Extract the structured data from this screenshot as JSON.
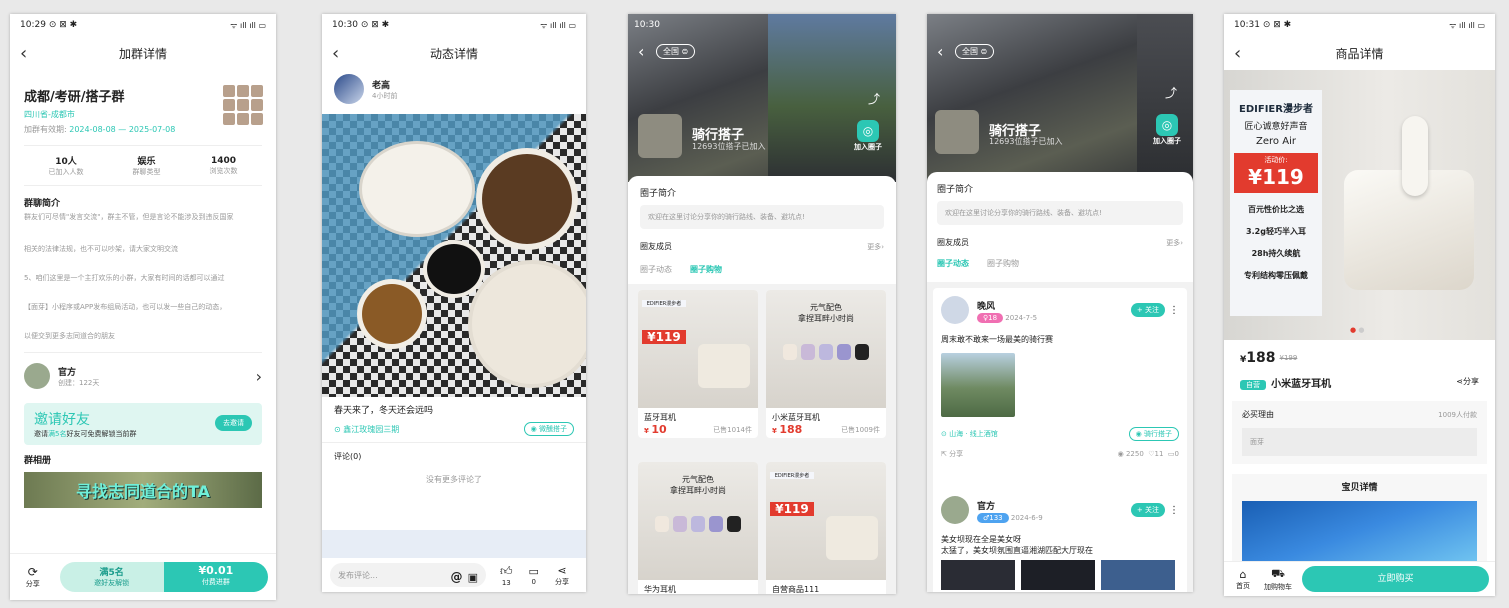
{
  "phone1": {
    "time": "10:29",
    "status_icons": "⊙ ⊠ ✱",
    "signal": "ᯤ ıll ıll ▭",
    "title": "加群详情",
    "group_name": "成都/考研/搭子群",
    "location": "四川省-成都市",
    "validity_label": "加群有效期:",
    "validity_value": "2024-08-08 — 2025-07-08",
    "stats": [
      {
        "value": "10人",
        "label": "已加入人数"
      },
      {
        "value": "娱乐",
        "label": "群聊类型"
      },
      {
        "value": "1400",
        "label": "浏览次数"
      }
    ],
    "intro_title": "群聊简介",
    "intro_lines": [
      "群友们可尽情\"发言交流\"，群主不管，但是言论不能涉及到违反国家",
      "相关的法律法规，也不可以吵架，请大家文明交流",
      "5、咱们这里是一个主打欢乐的小群，大家有时间的话都可以通过",
      "【面芽】小程序或APP发布组局活动，也可以发一些自己的动态，",
      "以便交到更多志同道合的朋友"
    ],
    "owner_name": "官方",
    "owner_sub": "创建：122天",
    "invite_title": "邀请好友",
    "invite_sub_pre": "邀请",
    "invite_sub_num": "满5名",
    "invite_sub_post": "好友可免费解锁当前群",
    "invite_btn": "去邀请",
    "album_title": "群相册",
    "album_banner": "寻找志同道合的TA",
    "share": "分享",
    "unlock_top": "满5名",
    "unlock_bottom": "邀好友解锁",
    "pay_top": "¥0.01",
    "pay_bottom": "付费进群"
  },
  "phone2": {
    "time": "10:30",
    "status_icons": "⊙ ⊠ ✱",
    "signal": "ᯤ ıll ıll ▭",
    "title": "动态详情",
    "author": "老高",
    "time_ago": "4小时前",
    "caption": "春天来了，冬天还会远吗",
    "location": "鑫江玫瑰园三期",
    "tag": "微醺搭子",
    "comments_title": "评论(0)",
    "no_more": "没有更多评论了",
    "input_placeholder": "发布评论...",
    "at": "@",
    "likes": "13",
    "comments": "0",
    "share": "分享"
  },
  "phone3": {
    "time": "10:30",
    "region": "全国",
    "circle_name": "骑行搭子",
    "circle_sub": "12693位搭子已加入",
    "join": "加入圈子",
    "intro_title": "圈子简介",
    "intro_text": "欢迎在这里讨论分享你的骑行路线、装备、避坑点!",
    "members_title": "圈友成员",
    "more": "更多",
    "tabs": [
      "圈子动态",
      "圈子购物"
    ],
    "active_tab": 1,
    "products": [
      {
        "name": "蓝牙耳机",
        "price": "10",
        "sold": "已售1014件",
        "brand": "EDIFIER漫步者",
        "promo": "119",
        "headline": ""
      },
      {
        "name": "小米蓝牙耳机",
        "price": "188",
        "sold": "已售1009件",
        "brand": "",
        "promo": "",
        "headline": "元气配色\n拿捏耳畔小时尚"
      },
      {
        "name": "华为耳机",
        "price": "",
        "sold": "",
        "brand": "",
        "promo": "",
        "headline": "元气配色\n拿捏耳畔小时尚"
      },
      {
        "name": "自营商品111",
        "price": "",
        "sold": "",
        "brand": "EDIFIER漫步者",
        "promo": "119",
        "headline": ""
      }
    ]
  },
  "phone4": {
    "region": "全国",
    "circle_name": "骑行搭子",
    "circle_sub": "12693位搭子已加入",
    "join": "加入圈子",
    "intro_title": "圈子简介",
    "intro_text": "欢迎在这里讨论分享你的骑行路线、装备、避坑点!",
    "members_title": "圈友成员",
    "more": "更多",
    "tabs": [
      "圈子动态",
      "圈子购物"
    ],
    "active_tab": 0,
    "posts": [
      {
        "name": "晚风",
        "badge": "♀18",
        "date": "2024-7-5",
        "follow": "+ 关注",
        "text": "周末敢不敢来一场最美的骑行赛",
        "location": "山海 · 线上酒馆",
        "tag": "骑行搭子",
        "share": "分享",
        "views": "2250",
        "likes": "11",
        "comments": "0"
      },
      {
        "name": "官方",
        "badge": "♂133",
        "date": "2024-6-9",
        "follow": "+ 关注",
        "text": "美女坝现在全是美女呀\n太猛了，美女坝氛围直逼湘湖匹配大厅现在",
        "location": "",
        "tag": "",
        "share": "",
        "views": "",
        "likes": "",
        "comments": ""
      }
    ]
  },
  "phone5": {
    "time": "10:31",
    "status_icons": "⊙ ⊠ ✱",
    "signal": "ᯤ ıll ıll ▭",
    "title": "商品详情",
    "brand": "EDIFIER漫步者",
    "slogan": "匠心诚意好声音",
    "model": "Zero Air",
    "promo_label": "活动价:",
    "promo_price": "119",
    "features": [
      "百元性价比之选",
      "3.2g轻巧半入耳",
      "28h持久续航",
      "专利结构零压佩戴"
    ],
    "price": "188",
    "price_old": "¥199",
    "self_tag": "自营",
    "product_name": "小米蓝牙耳机",
    "share": "分享",
    "reason_title": "必买理由",
    "buyers": "1009人付款",
    "reason_text": "面芽",
    "detail_title": "宝贝详情",
    "home": "首页",
    "cart": "加购物车",
    "buy": "立即购买"
  },
  "colors": {
    "accent": "#2cc7b4",
    "price": "#e23b2e",
    "badge_pink": "#f06fb2",
    "badge_blue": "#4ea3f0"
  }
}
